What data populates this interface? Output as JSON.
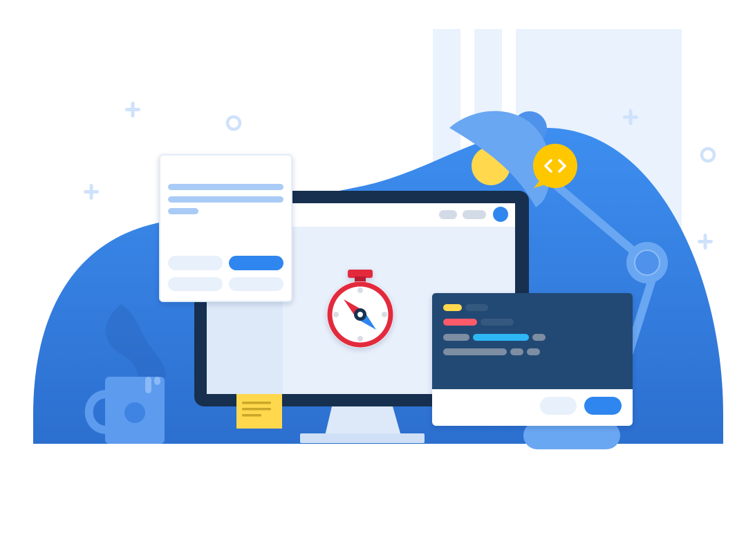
{
  "palette": {
    "background": "#ffffff",
    "hill_light": "#3d8ef0",
    "hill_dark": "#2c6fcf",
    "window_tint": "#e9f2fd",
    "lamp_blue": "#6aa7f2",
    "lamp_blue_dark": "#4f92eb",
    "lamp_bulb": "#ffd84d",
    "code_badge": "#ffc700",
    "monitor_frame": "#17304f",
    "monitor_screen": "#e8f0fb",
    "monitor_stand": "#dde9f8",
    "primary_button": "#2f86ee",
    "compass_ring": "#e3293e",
    "compass_needle_red": "#e3293e",
    "compass_needle_blue": "#2f86ee",
    "code_panel": "#244a73",
    "code_yellow": "#ffd84d",
    "code_red": "#ff5a6b",
    "code_cyan": "#2fb6f5",
    "code_gray": "#7d8ea3",
    "sticky_note": "#ffd84d",
    "mug": "#5c9bee",
    "sparkle": "#cfe2fb"
  },
  "icons": {
    "compass": "compass-icon",
    "code_badge": "code-brackets-icon",
    "mug": "coffee-mug-icon",
    "lamp": "desk-lamp-icon",
    "sticky_note": "sticky-note-icon"
  }
}
